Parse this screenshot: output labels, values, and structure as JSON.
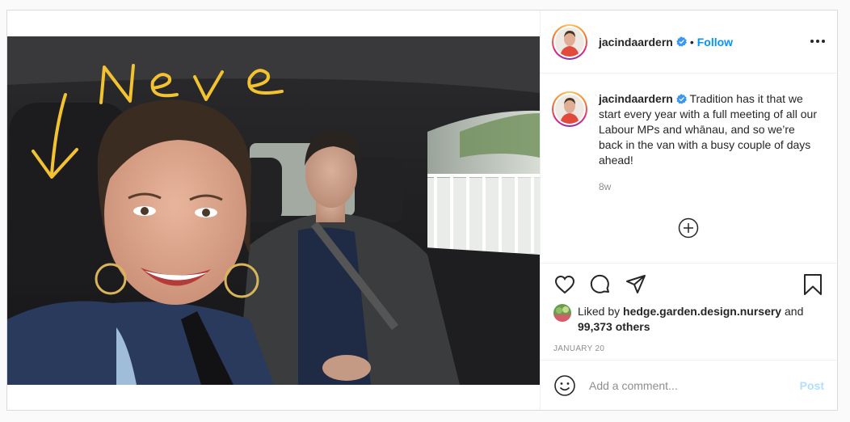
{
  "post": {
    "author": {
      "username": "jacindaardern",
      "verified": true,
      "follow_label": "Follow",
      "separator": "•"
    },
    "photo": {
      "handwritten_overlay": "Neve",
      "overlay_color": "#f2c230"
    },
    "caption": {
      "username": "jacindaardern",
      "text": "Tradition has it that we start every year with a full meeting of all our Labour MPs and whānau, and so we’re back in the van with a busy couple of days ahead!",
      "timestamp": "8w"
    },
    "actions": {
      "icons": [
        "heart-icon",
        "comment-icon",
        "share-icon",
        "bookmark-icon",
        "plus-circle-icon",
        "more-icon",
        "emoji-icon"
      ]
    },
    "likes": {
      "prefix": "Liked by",
      "liker": "hedge.garden.design.nursery",
      "middle": "and",
      "others": "99,373 others"
    },
    "date": "JANUARY 20",
    "comment_box": {
      "placeholder": "Add a comment...",
      "post_label": "Post"
    },
    "colors": {
      "link_blue": "#0095f6",
      "post_disabled": "#b2dffc",
      "verified_blue": "#3897f0"
    }
  }
}
